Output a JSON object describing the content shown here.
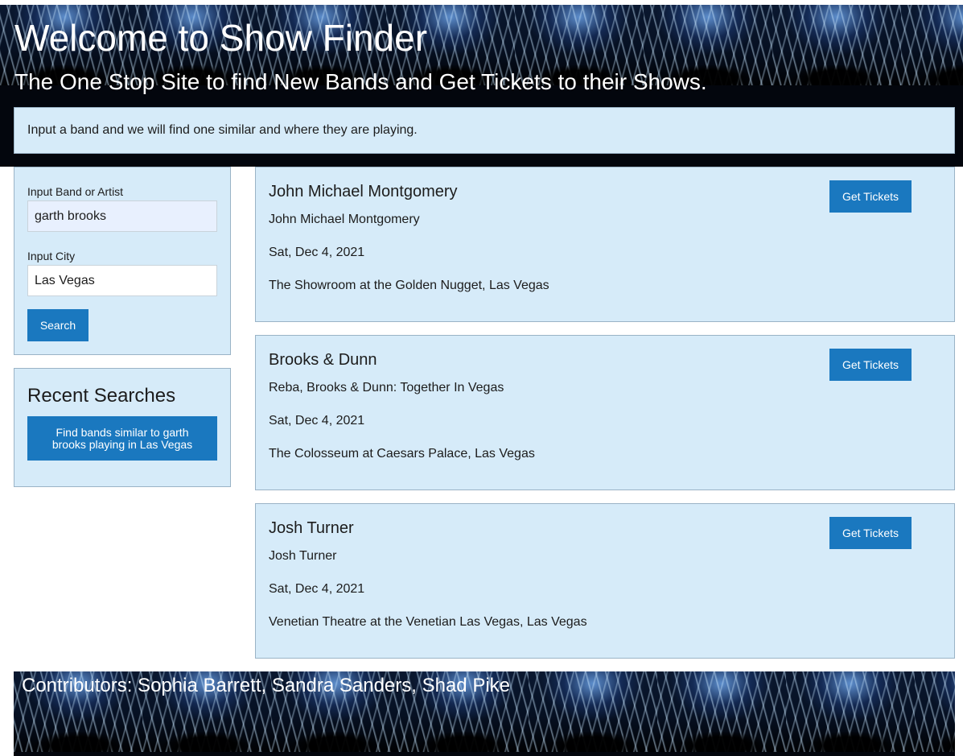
{
  "header": {
    "title": "Welcome to Show Finder",
    "subtitle": "The One Stop Site to find New Bands and Get Tickets to their Shows.",
    "intro": "Input a band and we will find one similar and where they are playing."
  },
  "search": {
    "band_label": "Input Band or Artist",
    "band_value": "garth brooks",
    "city_label": "Input City",
    "city_value": "Las Vegas",
    "button_label": "Search"
  },
  "recent": {
    "title": "Recent Searches",
    "items": [
      {
        "label": "Find bands similar to garth brooks playing in Las Vegas"
      }
    ]
  },
  "results": [
    {
      "band": "John Michael Montgomery",
      "event": "John Michael Montgomery",
      "date": "Sat, Dec 4, 2021",
      "venue": "The Showroom at the Golden Nugget, Las Vegas",
      "button_label": "Get Tickets"
    },
    {
      "band": "Brooks & Dunn",
      "event": "Reba, Brooks & Dunn: Together In Vegas",
      "date": "Sat, Dec 4, 2021",
      "venue": "The Colosseum at Caesars Palace, Las Vegas",
      "button_label": "Get Tickets"
    },
    {
      "band": "Josh Turner",
      "event": "Josh Turner",
      "date": "Sat, Dec 4, 2021",
      "venue": "Venetian Theatre at the Venetian Las Vegas, Las Vegas",
      "button_label": "Get Tickets"
    }
  ],
  "footer": {
    "contributors": "Contributors: Sophia Barrett, Sandra Sanders, Shad Pike"
  },
  "colors": {
    "panel_bg": "#d6ebf9",
    "button_bg": "#1a78bf"
  }
}
